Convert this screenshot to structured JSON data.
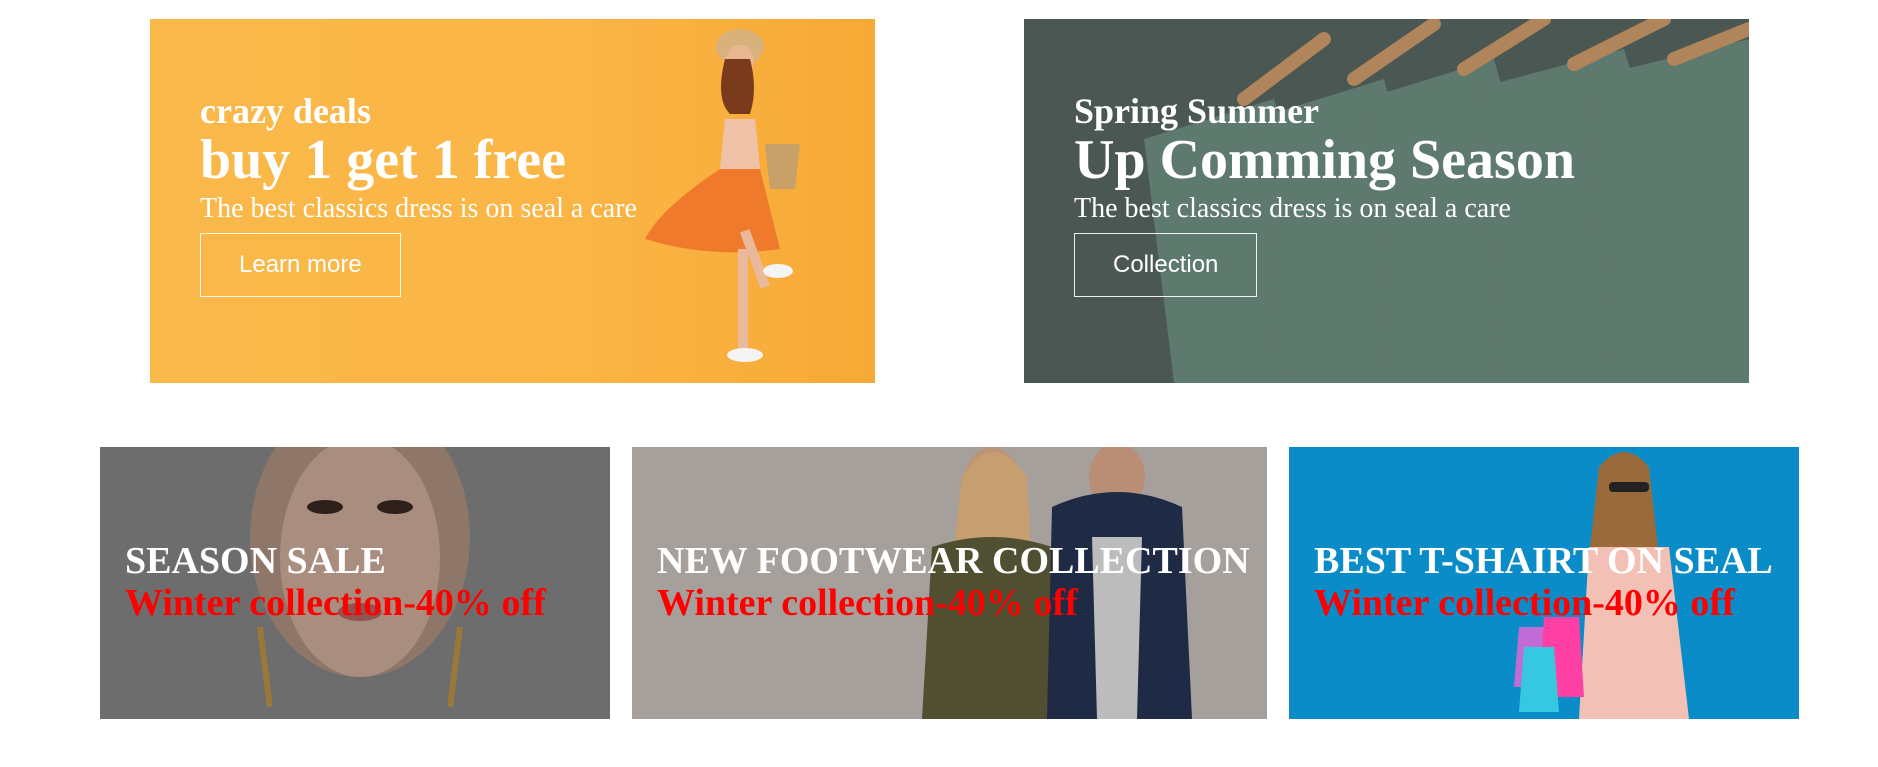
{
  "banners_top": [
    {
      "pre_title": "crazy deals",
      "title": "buy 1 get 1 free",
      "description": "The best classics dress is on seal a care",
      "button_label": "Learn more"
    },
    {
      "pre_title": "Spring Summer",
      "title": "Up Comming Season",
      "description": "The best classics dress is on seal a care",
      "button_label": "Collection"
    }
  ],
  "banners_bottom": [
    {
      "title": "SEASON SALE",
      "subtitle": "Winter collection-40% off"
    },
    {
      "title": "NEW FOOTWEAR COLLECTION",
      "subtitle": "Winter collection-40% off"
    },
    {
      "title": "BEST T-SHAIRT ON SEAL",
      "subtitle": "Winter collection-40% off"
    }
  ],
  "colors": {
    "orange_banner": "#fbb545",
    "green_banner": "#5e6a66",
    "gray_banner": "#8c8c8e",
    "beige_banner": "#bdb7b3",
    "blue_banner": "#0a8cc8",
    "subtitle_red": "#ff0000"
  }
}
